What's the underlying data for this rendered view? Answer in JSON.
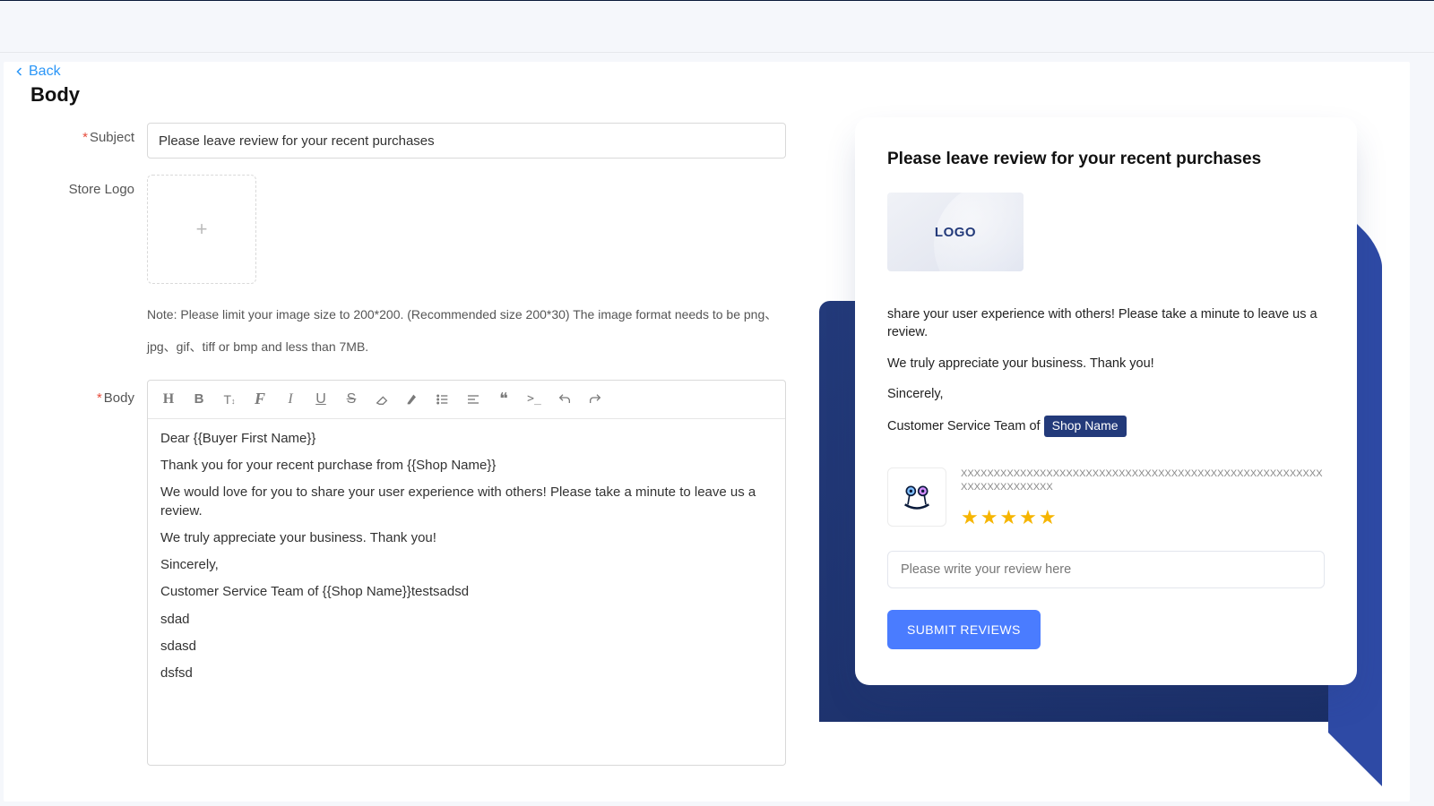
{
  "nav": {
    "back_label": "Back"
  },
  "section_title": "Body",
  "form": {
    "subject_label": "Subject",
    "subject_value": "Please leave review for your recent purchases",
    "store_logo_label": "Store Logo",
    "logo_note": "Note: Please limit your image size to 200*200. (Recommended size 200*30) The image format needs to be png、jpg、gif、tiff or bmp and less than 7MB.",
    "body_label": "Body"
  },
  "editor": {
    "lines": [
      "Dear {{Buyer First Name}}",
      "Thank you for your recent purchase from {{Shop Name}}",
      "We would love for you to share your user experience with others! Please take a minute to leave us a review.",
      "We truly appreciate your business. Thank you!",
      "Sincerely,",
      "Customer Service Team of {{Shop Name}}testsadsd",
      "sdad",
      "sdasd",
      "dsfsd"
    ],
    "faded_lines": [
      "",
      "",
      ""
    ]
  },
  "preview": {
    "title": "Please leave review for your recent purchases",
    "logo_text": "LOGO",
    "p1": "share your user experience with others! Please take a minute to leave us a review.",
    "p2": "We truly appreciate your business. Thank you!",
    "p3": "Sincerely,",
    "p4_prefix": "Customer Service Team of",
    "shop_tag": "Shop Name",
    "product_name": "XXXXXXXXXXXXXXXXXXXXXXXXXXXXXXXXXXXXXXXXXXXXXXXXXXXXXXXXXXXXXXXXXXXXX",
    "review_placeholder": "Please write your review here",
    "submit_label": "SUBMIT REVIEWS"
  }
}
